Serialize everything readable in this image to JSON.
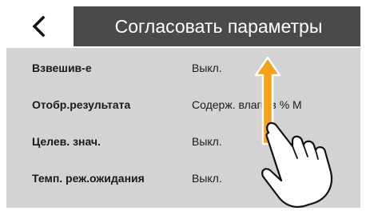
{
  "header": {
    "back_icon": "chevron-left-icon",
    "title": "Согласовать параметры"
  },
  "settings": [
    {
      "label": "Взвешив-е",
      "value": "Выкл."
    },
    {
      "label": "Отобр.результата",
      "value": "Содерж. влаги в % М"
    },
    {
      "label": "Целев. знач.",
      "value": "Выкл."
    },
    {
      "label": "Темп. реж.ожидания",
      "value": "Выкл."
    }
  ],
  "gesture": {
    "type": "swipe-up",
    "icon": "hand-pointer-icon",
    "arrow_icon": "arrow-up-icon",
    "arrow_color": "#f5a21b"
  },
  "colors": {
    "header_bg": "#4a4a4a",
    "content_bg": "#d3d3d3",
    "accent": "#f5a21b"
  }
}
